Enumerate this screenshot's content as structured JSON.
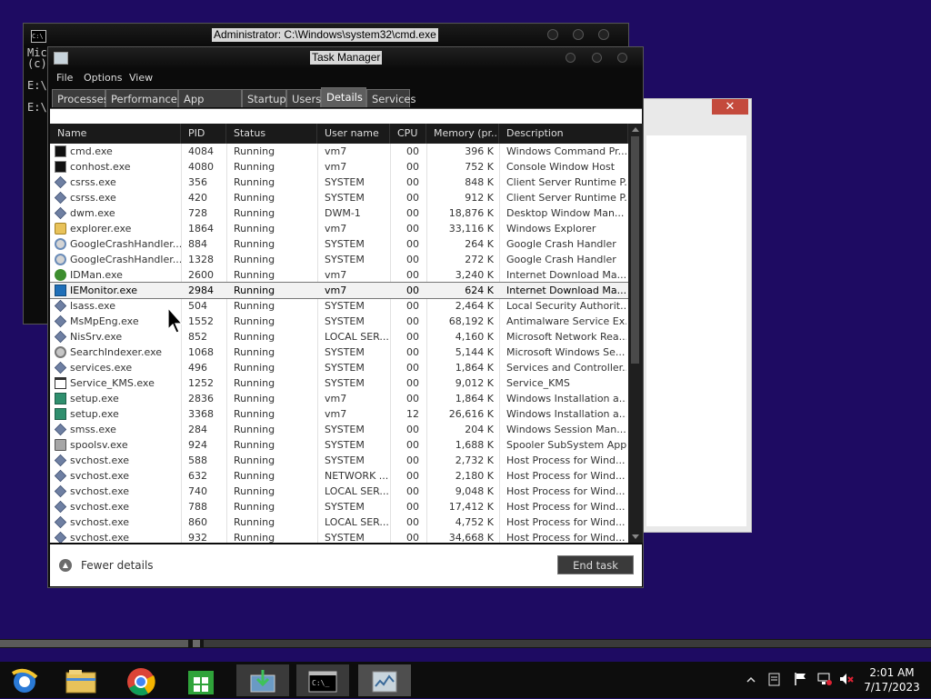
{
  "cmd": {
    "title": "Administrator: C:\\Windows\\system32\\cmd.exe",
    "lines": [
      "Mic",
      "(c)",
      "",
      "E:\\",
      "",
      "E:\\"
    ]
  },
  "tm": {
    "title": "Task Manager",
    "menu": [
      "File",
      "Options",
      "View"
    ],
    "tabs": [
      "Processes",
      "Performance",
      "App history",
      "Startup",
      "Users",
      "Details",
      "Services"
    ],
    "active_tab": "Details",
    "columns": [
      "Name",
      "PID",
      "Status",
      "User name",
      "CPU",
      "Memory (pr...",
      "Description"
    ],
    "rows": [
      {
        "icon": "cmd-icon",
        "name": "cmd.exe",
        "pid": "4084",
        "status": "Running",
        "user": "vm7",
        "cpu": "00",
        "mem": "396 K",
        "desc": "Windows Command Pr..."
      },
      {
        "icon": "cmd-icon",
        "name": "conhost.exe",
        "pid": "4080",
        "status": "Running",
        "user": "vm7",
        "cpu": "00",
        "mem": "752 K",
        "desc": "Console Window Host"
      },
      {
        "icon": "process-icon",
        "name": "csrss.exe",
        "pid": "356",
        "status": "Running",
        "user": "SYSTEM",
        "cpu": "00",
        "mem": "848 K",
        "desc": "Client Server Runtime P..."
      },
      {
        "icon": "process-icon",
        "name": "csrss.exe",
        "pid": "420",
        "status": "Running",
        "user": "SYSTEM",
        "cpu": "00",
        "mem": "912 K",
        "desc": "Client Server Runtime P..."
      },
      {
        "icon": "process-icon",
        "name": "dwm.exe",
        "pid": "728",
        "status": "Running",
        "user": "DWM-1",
        "cpu": "00",
        "mem": "18,876 K",
        "desc": "Desktop Window Man..."
      },
      {
        "icon": "folder-icon",
        "name": "explorer.exe",
        "pid": "1864",
        "status": "Running",
        "user": "vm7",
        "cpu": "00",
        "mem": "33,116 K",
        "desc": "Windows Explorer"
      },
      {
        "icon": "crash-handler-icon",
        "name": "GoogleCrashHandler....",
        "pid": "884",
        "status": "Running",
        "user": "SYSTEM",
        "cpu": "00",
        "mem": "264 K",
        "desc": "Google Crash Handler"
      },
      {
        "icon": "crash-handler-icon",
        "name": "GoogleCrashHandler....",
        "pid": "1328",
        "status": "Running",
        "user": "SYSTEM",
        "cpu": "00",
        "mem": "272 K",
        "desc": "Google Crash Handler"
      },
      {
        "icon": "idm-icon",
        "name": "IDMan.exe",
        "pid": "2600",
        "status": "Running",
        "user": "vm7",
        "cpu": "00",
        "mem": "3,240 K",
        "desc": "Internet Download Ma..."
      },
      {
        "icon": "ie-monitor-icon",
        "name": "IEMonitor.exe",
        "pid": "2984",
        "status": "Running",
        "user": "vm7",
        "cpu": "00",
        "mem": "624 K",
        "desc": "Internet Download Ma...",
        "selected": true
      },
      {
        "icon": "process-icon",
        "name": "lsass.exe",
        "pid": "504",
        "status": "Running",
        "user": "SYSTEM",
        "cpu": "00",
        "mem": "2,464 K",
        "desc": "Local Security Authorit..."
      },
      {
        "icon": "process-icon",
        "name": "MsMpEng.exe",
        "pid": "1552",
        "status": "Running",
        "user": "SYSTEM",
        "cpu": "00",
        "mem": "68,192 K",
        "desc": "Antimalware Service Ex..."
      },
      {
        "icon": "process-icon",
        "name": "NisSrv.exe",
        "pid": "852",
        "status": "Running",
        "user": "LOCAL SER...",
        "cpu": "00",
        "mem": "4,160 K",
        "desc": "Microsoft Network Rea..."
      },
      {
        "icon": "search-indexer-icon",
        "name": "SearchIndexer.exe",
        "pid": "1068",
        "status": "Running",
        "user": "SYSTEM",
        "cpu": "00",
        "mem": "5,144 K",
        "desc": "Microsoft Windows Se..."
      },
      {
        "icon": "process-icon",
        "name": "services.exe",
        "pid": "496",
        "status": "Running",
        "user": "SYSTEM",
        "cpu": "00",
        "mem": "1,864 K",
        "desc": "Services and Controller..."
      },
      {
        "icon": "window-icon",
        "name": "Service_KMS.exe",
        "pid": "1252",
        "status": "Running",
        "user": "SYSTEM",
        "cpu": "00",
        "mem": "9,012 K",
        "desc": "Service_KMS"
      },
      {
        "icon": "setup-icon",
        "name": "setup.exe",
        "pid": "2836",
        "status": "Running",
        "user": "vm7",
        "cpu": "00",
        "mem": "1,864 K",
        "desc": "Windows Installation a..."
      },
      {
        "icon": "setup-icon",
        "name": "setup.exe",
        "pid": "3368",
        "status": "Running",
        "user": "vm7",
        "cpu": "12",
        "mem": "26,616 K",
        "desc": "Windows Installation a..."
      },
      {
        "icon": "process-icon",
        "name": "smss.exe",
        "pid": "284",
        "status": "Running",
        "user": "SYSTEM",
        "cpu": "00",
        "mem": "204 K",
        "desc": "Windows Session Man..."
      },
      {
        "icon": "printer-icon",
        "name": "spoolsv.exe",
        "pid": "924",
        "status": "Running",
        "user": "SYSTEM",
        "cpu": "00",
        "mem": "1,688 K",
        "desc": "Spooler SubSystem App"
      },
      {
        "icon": "process-icon",
        "name": "svchost.exe",
        "pid": "588",
        "status": "Running",
        "user": "SYSTEM",
        "cpu": "00",
        "mem": "2,732 K",
        "desc": "Host Process for Wind..."
      },
      {
        "icon": "process-icon",
        "name": "svchost.exe",
        "pid": "632",
        "status": "Running",
        "user": "NETWORK ...",
        "cpu": "00",
        "mem": "2,180 K",
        "desc": "Host Process for Wind..."
      },
      {
        "icon": "process-icon",
        "name": "svchost.exe",
        "pid": "740",
        "status": "Running",
        "user": "LOCAL SER...",
        "cpu": "00",
        "mem": "9,048 K",
        "desc": "Host Process for Wind..."
      },
      {
        "icon": "process-icon",
        "name": "svchost.exe",
        "pid": "788",
        "status": "Running",
        "user": "SYSTEM",
        "cpu": "00",
        "mem": "17,412 K",
        "desc": "Host Process for Wind..."
      },
      {
        "icon": "process-icon",
        "name": "svchost.exe",
        "pid": "860",
        "status": "Running",
        "user": "LOCAL SER...",
        "cpu": "00",
        "mem": "4,752 K",
        "desc": "Host Process for Wind..."
      },
      {
        "icon": "process-icon",
        "name": "svchost.exe",
        "pid": "932",
        "status": "Running",
        "user": "SYSTEM",
        "cpu": "00",
        "mem": "34,668 K",
        "desc": "Host Process for Wind..."
      }
    ],
    "fewer_details": "Fewer details",
    "end_task": "End task"
  },
  "taskbar": {
    "apps": [
      "ie-icon",
      "file-explorer-icon",
      "chrome-icon",
      "store-icon",
      "installer-icon",
      "cmd-icon",
      "task-manager-icon"
    ],
    "tray_icons": [
      "chevron-up-icon",
      "action-center-icon",
      "flag-icon",
      "network-icon",
      "volume-muted-icon"
    ],
    "time": "2:01 AM",
    "date": "7/17/2023"
  },
  "colors": {
    "desktop": "#1e0b62",
    "accent_close": "#c44a3c",
    "window_dark": "#0b0b0b"
  }
}
